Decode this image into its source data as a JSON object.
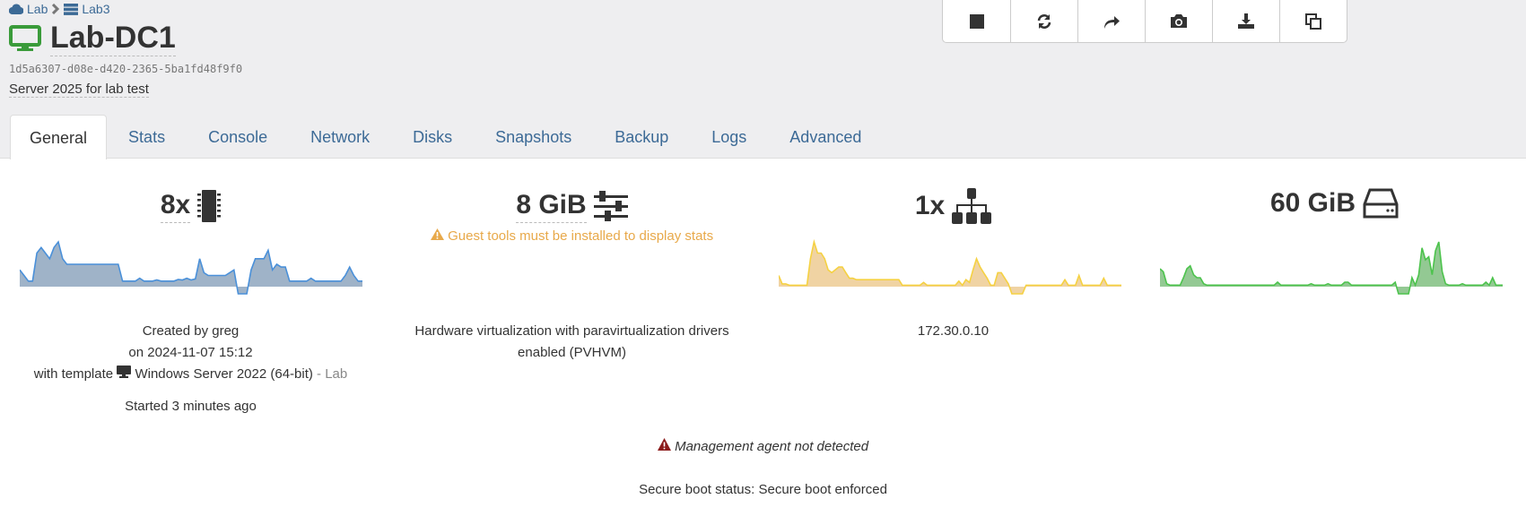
{
  "breadcrumb": {
    "pool": "Lab",
    "host": "Lab3"
  },
  "vm": {
    "name": "Lab-DC1",
    "uuid": "1d5a6307-d08e-d420-2365-5ba1fd48f9f0",
    "description": "Server 2025 for lab test"
  },
  "toolbar": [
    {
      "icon": "stop-icon"
    },
    {
      "icon": "refresh-icon"
    },
    {
      "icon": "share-icon"
    },
    {
      "icon": "camera-icon"
    },
    {
      "icon": "download-icon"
    },
    {
      "icon": "copy-icon"
    }
  ],
  "tabs": [
    "General",
    "Stats",
    "Console",
    "Network",
    "Disks",
    "Snapshots",
    "Backup",
    "Logs",
    "Advanced"
  ],
  "active_tab": "General",
  "stats": {
    "cpu": {
      "value": "8x",
      "icon": "cpu-icon",
      "color": "#4a90d9",
      "fill": "#9fb3c8",
      "spark": [
        3,
        2,
        1,
        1,
        6,
        7,
        6,
        5,
        7,
        8,
        5,
        4,
        4,
        4,
        4,
        4,
        4,
        4,
        4,
        4,
        4,
        4,
        4,
        4,
        1,
        1,
        1,
        1,
        1.5,
        1,
        1,
        1,
        1.2,
        1,
        1,
        1,
        1,
        1.3,
        1.2,
        1.5,
        1.2,
        1.4,
        5,
        2.5,
        2,
        2,
        2,
        2,
        2,
        2.5,
        3,
        -1,
        -1,
        -1,
        3,
        5,
        5,
        5,
        6.5,
        3,
        4,
        3.5,
        3.5,
        1,
        1,
        1,
        1,
        1,
        1.5,
        1,
        1,
        1,
        1,
        1,
        1,
        1,
        2,
        3.5,
        2,
        1,
        1
      ]
    },
    "memory": {
      "value": "8 GiB",
      "icon": "sliders-icon",
      "warning": "Guest tools must be installed to display stats",
      "warning_color": "#e8a94a"
    },
    "network": {
      "value": "1x",
      "icon": "sitemap-icon",
      "color": "#f5d142",
      "fill": "#f0d3a3",
      "spark": [
        4,
        1,
        1,
        0.5,
        0.5,
        0.5,
        0.5,
        0.5,
        0.5,
        10,
        16,
        12,
        12,
        10,
        6,
        5,
        6,
        7,
        7,
        5,
        3,
        3,
        2.5,
        2.5,
        2.5,
        2.5,
        2.5,
        2.5,
        2.5,
        2.5,
        2.5,
        2.5,
        2.5,
        2.5,
        2.5,
        0.5,
        0.5,
        0.5,
        0.5,
        0.5,
        0.5,
        1.5,
        0.5,
        0.5,
        0.5,
        0.5,
        0.5,
        0.5,
        0.5,
        0.5,
        0.5,
        2,
        0.5,
        2.5,
        1.5,
        6,
        10,
        7,
        5,
        3,
        0.5,
        0.5,
        5,
        5,
        3,
        1,
        -1,
        -1,
        -1,
        -1,
        0.5,
        0.5,
        0.5,
        0.5,
        0.5,
        0.5,
        0.5,
        0.5,
        0.5,
        0.5,
        0.5,
        2.5,
        0.5,
        0.5,
        0.5,
        4,
        0.5,
        0.5,
        0.5,
        0.5,
        0.5,
        0.5,
        3,
        0.5,
        0.5,
        0.5,
        0.5,
        0.5
      ]
    },
    "disk": {
      "value": "60 GiB",
      "icon": "hdd-icon",
      "color": "#4cc34c",
      "fill": "#93c993",
      "spark": [
        6,
        5,
        1,
        0.5,
        0.5,
        0.5,
        0.5,
        3,
        6,
        7,
        4,
        3,
        3,
        1,
        0.5,
        0.5,
        0.5,
        0.5,
        0.5,
        0.5,
        0.5,
        0.5,
        0.5,
        0.5,
        0.5,
        0.5,
        0.5,
        0.5,
        0.5,
        0.5,
        0.5,
        0.5,
        0.5,
        0.5,
        0.5,
        1.5,
        0.5,
        0.5,
        0.5,
        0.5,
        0.5,
        0.5,
        0.5,
        0.5,
        0.5,
        1,
        0.5,
        0.5,
        0.5,
        0.5,
        1,
        0.5,
        0.5,
        0.5,
        0.5,
        1.5,
        1.5,
        0.5,
        0.5,
        0.5,
        0.5,
        0.5,
        0.5,
        0.5,
        0.5,
        0.5,
        0.5,
        0.5,
        0.5,
        0.5,
        1.5,
        -1,
        -1,
        -1,
        -1,
        3,
        0.5,
        4,
        13,
        9,
        10,
        4,
        12,
        15,
        5,
        1,
        0.5,
        0.5,
        0.5,
        0.5,
        1,
        0.5,
        0.5,
        0.5,
        0.5,
        0.5,
        0.5,
        1.5,
        0.5,
        3,
        0.5,
        0.5,
        0.5
      ]
    }
  },
  "general": {
    "created_by": "Created by greg",
    "created_on": "on 2024-11-07 15:12",
    "template_prefix": "with template",
    "template_name": "Windows Server 2022 (64-bit)",
    "template_pool": "- Lab",
    "started": "Started 3 minutes ago"
  },
  "virtualization": "Hardware virtualization with paravirtualization drivers enabled (PVHVM)",
  "ip": "172.30.0.10",
  "management_warning": "Management agent not detected",
  "management_color": "#8b1a1a",
  "secure_boot": "Secure boot status: Secure boot enforced"
}
